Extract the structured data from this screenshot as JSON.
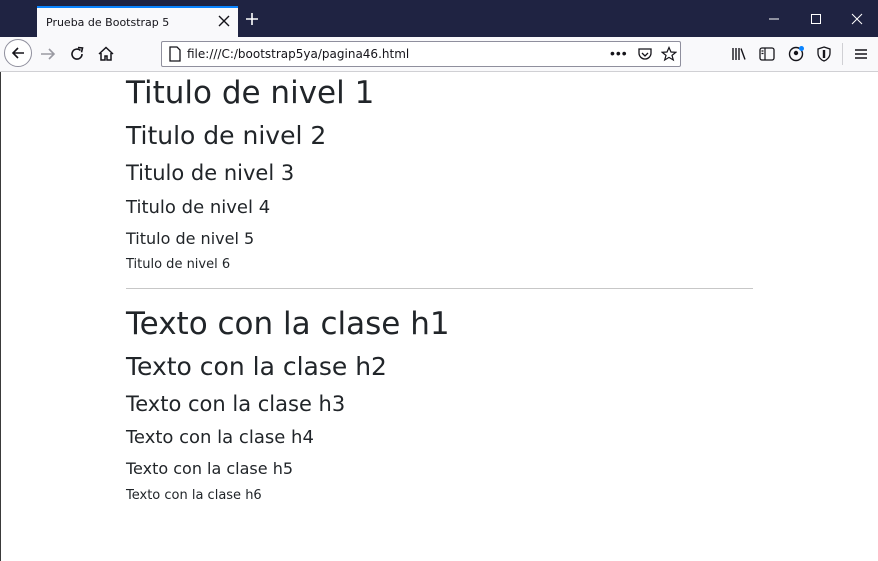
{
  "browser": {
    "tab_title": "Prueba de Bootstrap 5",
    "url": "file:///C:/bootstrap5ya/pagina46.html",
    "more_label": "•••",
    "icons": {
      "tab_close": "close-icon",
      "new_tab": "plus-icon",
      "back": "arrow-left-icon",
      "forward": "arrow-right-icon",
      "reload": "reload-icon",
      "home": "home-icon",
      "page": "page-icon",
      "pocket": "pocket-icon",
      "bookmark": "star-icon",
      "library": "library-icon",
      "sidebar": "sidebar-icon",
      "account": "account-icon",
      "shield": "shield-icon",
      "menu": "hamburger-icon"
    }
  },
  "headings": [
    "Titulo de nivel 1",
    "Titulo de nivel 2",
    "Titulo de nivel 3",
    "Titulo de nivel 4",
    "Titulo de nivel 5",
    "Titulo de nivel 6"
  ],
  "class_texts": [
    "Texto con la clase h1",
    "Texto con la clase h2",
    "Texto con la clase h3",
    "Texto con la clase h4",
    "Texto con la clase h5",
    "Texto con la clase h6"
  ],
  "colors": {
    "titlebar": "#1f2342",
    "accent": "#0a84ff",
    "text": "#212529"
  }
}
